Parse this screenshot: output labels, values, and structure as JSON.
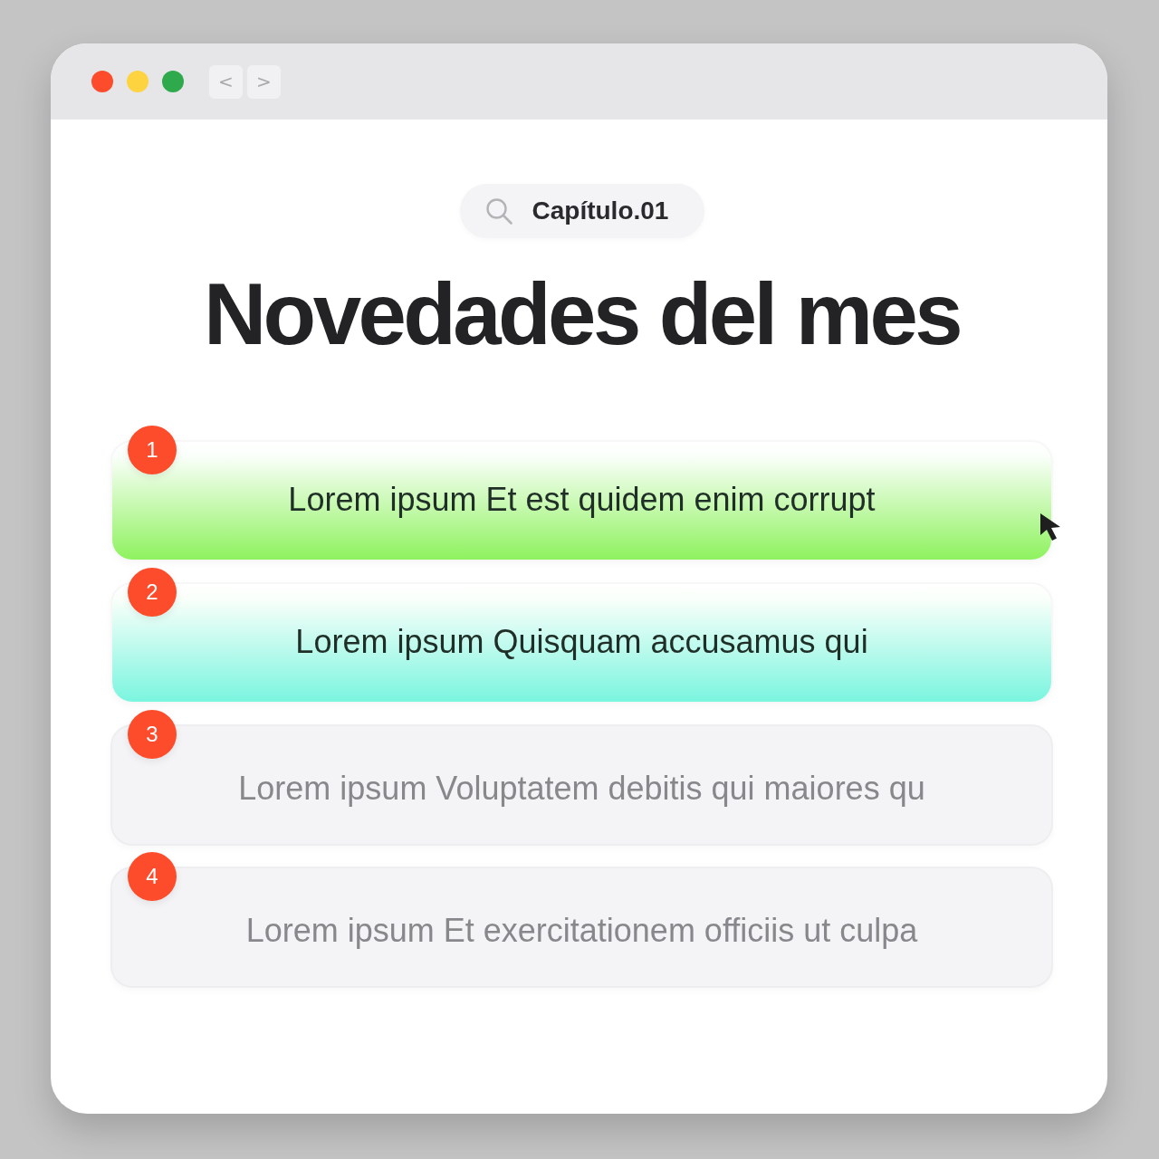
{
  "nav_buttons": [
    {
      "label": "<"
    },
    {
      "label": ">"
    }
  ],
  "search": {
    "value": "Capítulo.01"
  },
  "title": "Novedades del mes",
  "items": [
    {
      "number": "1",
      "text": "Lorem ipsum Et est quidem enim corrupt",
      "highlighted": true,
      "color": "#8ef25e"
    },
    {
      "number": "2",
      "text": "Lorem ipsum Quisquam accusamus qui",
      "highlighted": true,
      "color": "#7af5df"
    },
    {
      "number": "3",
      "text": "Lorem ipsum Voluptatem debitis qui maiores qu",
      "highlighted": false
    },
    {
      "number": "4",
      "text": "Lorem ipsum Et exercitationem officiis ut culpa",
      "highlighted": false
    }
  ]
}
